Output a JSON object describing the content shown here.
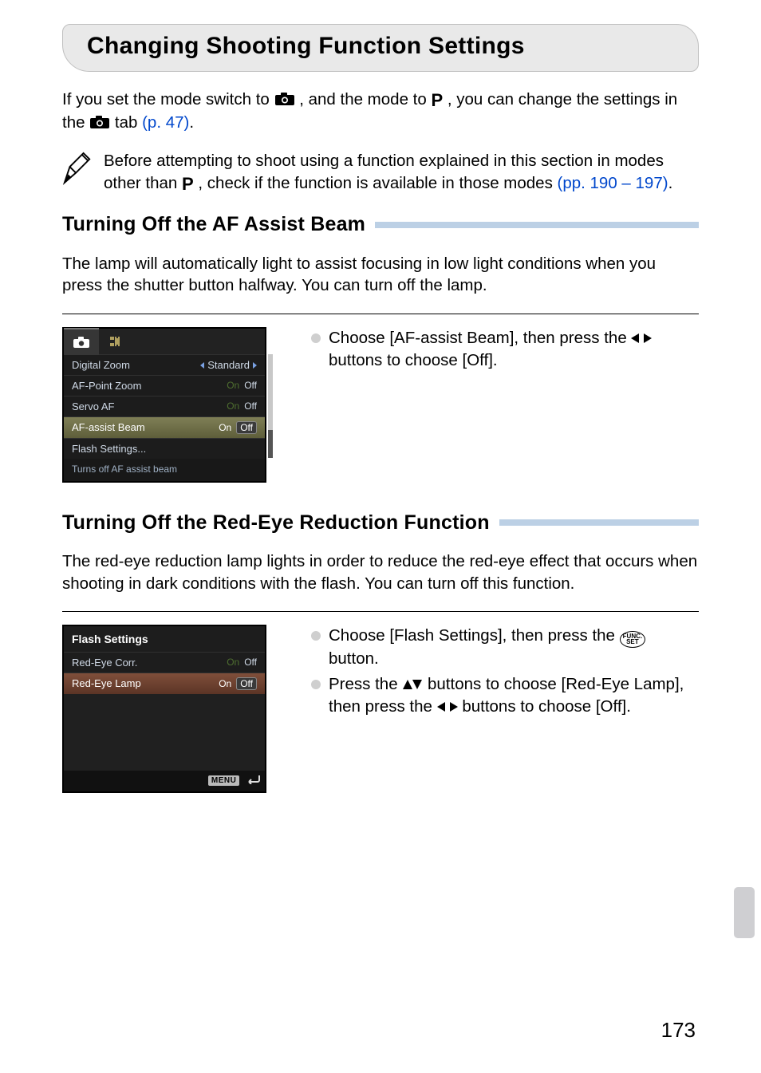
{
  "title": "Changing Shooting Function Settings",
  "intro": {
    "t1": "If you set the mode switch to ",
    "t2": ", and the mode to ",
    "t3": ", you can change the settings in the ",
    "t4": " tab ",
    "ref": "(p. 47)",
    "t5": "."
  },
  "p_glyph": "P",
  "notice": {
    "t1": "Before attempting to shoot using a function explained in this section in modes other than ",
    "t2": ", check if the function is available in those modes ",
    "ref": "(pp. 190 – 197)",
    "t3": "."
  },
  "sect1": {
    "title": "Turning Off the AF Assist Beam",
    "desc": "The lamp will automatically light to assist focusing in low light conditions when you press the shutter button halfway. You can turn off the lamp.",
    "bullet1a": "Choose [AF-assist Beam], then press the ",
    "bullet1b": " buttons to choose [Off]."
  },
  "menu1": {
    "items": [
      {
        "label": "Digital Zoom",
        "value": "Standard",
        "type": "lr"
      },
      {
        "label": "AF-Point Zoom",
        "value": "Off",
        "type": "onoff"
      },
      {
        "label": "Servo AF",
        "value": "Off",
        "type": "onoff"
      },
      {
        "label": "AF-assist Beam",
        "value": "Off",
        "type": "onoff_sel"
      },
      {
        "label": "Flash Settings...",
        "value": "",
        "type": "sub"
      }
    ],
    "on_label": "On",
    "footer": "Turns off AF assist beam"
  },
  "sect2": {
    "title": "Turning Off the Red-Eye Reduction Function",
    "desc": "The red-eye reduction lamp lights in order to reduce the red-eye effect that occurs when shooting in dark conditions with the flash. You can turn off this function.",
    "bullet1a": "Choose [Flash Settings], then press the ",
    "bullet1b": " button.",
    "bullet2a": "Press the ",
    "bullet2b": " buttons to choose [Red-Eye Lamp], then press the ",
    "bullet2c": " buttons to choose [Off]."
  },
  "menu2": {
    "header": "Flash Settings",
    "items": [
      {
        "label": "Red-Eye Corr.",
        "value": "Off"
      },
      {
        "label": "Red-Eye Lamp",
        "value_on": "On",
        "value": "Off",
        "sel": true
      }
    ],
    "menu_label": "MENU"
  },
  "funcset": {
    "l1": "FUNC.",
    "l2": "SET"
  },
  "pagenum": "173"
}
